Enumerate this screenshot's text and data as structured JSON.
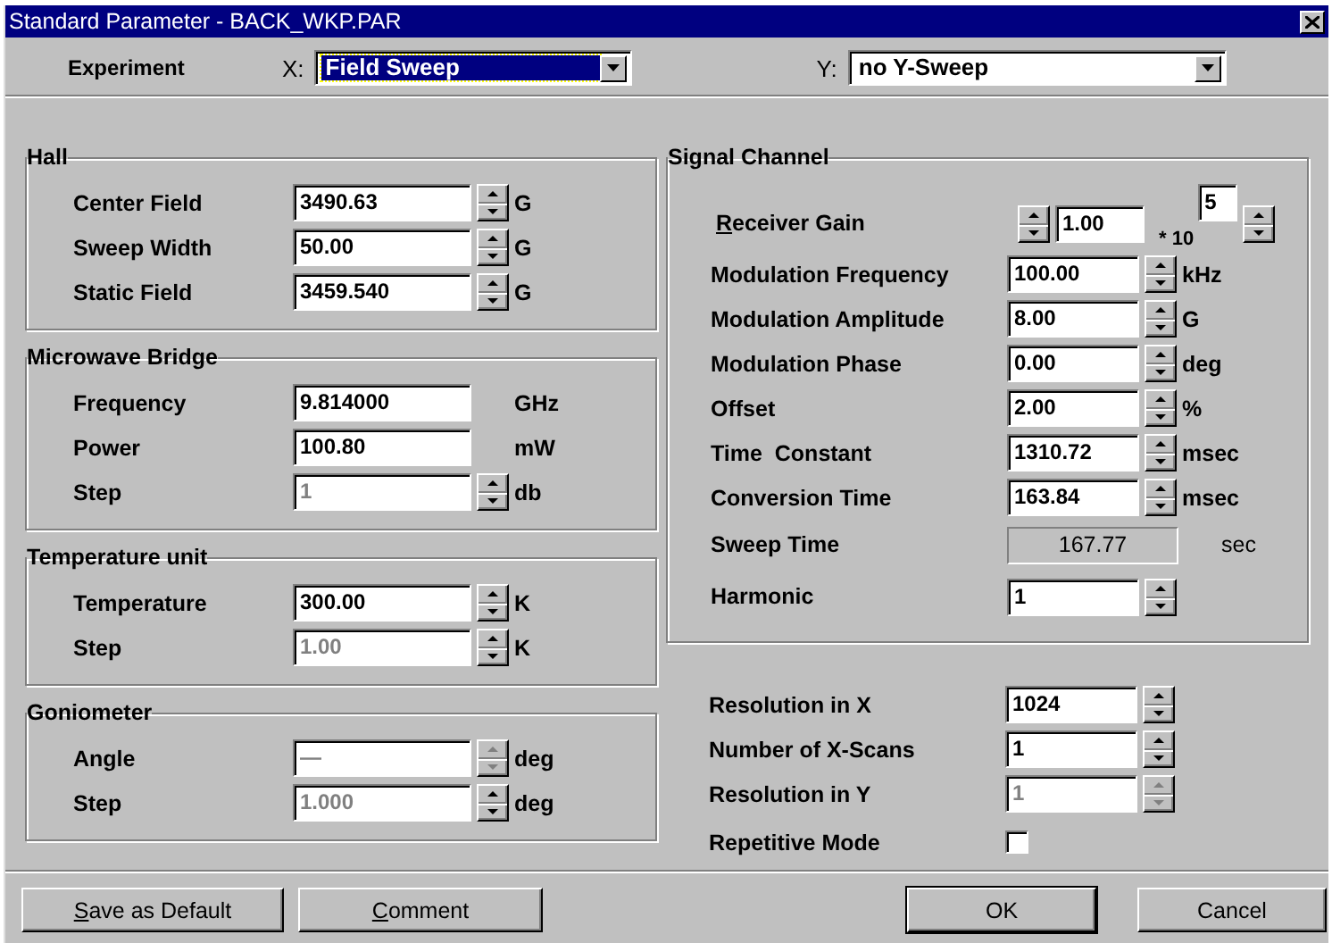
{
  "window": {
    "title": "Standard Parameter - BACK_WKP.PAR"
  },
  "experiment": {
    "label": "Experiment",
    "x": {
      "label": "X:",
      "value": "Field Sweep",
      "focused": true
    },
    "y": {
      "label": "Y:",
      "value": "no Y-Sweep",
      "focused": false
    }
  },
  "left_groups": [
    {
      "title": "Hall",
      "rows": [
        {
          "kind": "spin",
          "label": "Center Field",
          "value": "3490.63",
          "unit": "G",
          "disabled": false,
          "spinner_disabled": false
        },
        {
          "kind": "spin",
          "label": "Sweep Width",
          "value": "50.00",
          "unit": "G",
          "disabled": false,
          "spinner_disabled": false
        },
        {
          "kind": "spin",
          "label": "Static Field",
          "value": "3459.540",
          "unit": "G",
          "disabled": false,
          "spinner_disabled": false
        }
      ]
    },
    {
      "title": "Microwave Bridge",
      "rows": [
        {
          "kind": "plain",
          "label": "Frequency",
          "value": "9.814000",
          "unit": "GHz",
          "disabled": false
        },
        {
          "kind": "plain",
          "label": "Power",
          "value": "100.80",
          "unit": "mW",
          "disabled": false
        },
        {
          "kind": "spin",
          "label": "Step",
          "value": "1",
          "unit": "db",
          "disabled": true,
          "spinner_disabled": false
        }
      ]
    },
    {
      "title": "Temperature unit",
      "rows": [
        {
          "kind": "spin",
          "label": "Temperature",
          "value": "300.00",
          "unit": "K",
          "disabled": false,
          "spinner_disabled": false
        },
        {
          "kind": "spin",
          "label": "Step",
          "value": "1.00",
          "unit": "K",
          "disabled": true,
          "spinner_disabled": false
        }
      ]
    },
    {
      "title": "Goniometer",
      "rows": [
        {
          "kind": "spin",
          "label": "Angle",
          "value": "—",
          "unit": "deg",
          "disabled": true,
          "spinner_disabled": true
        },
        {
          "kind": "spin",
          "label": "Step",
          "value": "1.000",
          "unit": "deg",
          "disabled": true,
          "spinner_disabled": false
        }
      ]
    }
  ],
  "signal_channel": {
    "title": "Signal Channel",
    "rows": [
      {
        "kind": "gain",
        "label": "Receiver Gain",
        "underline_first": true,
        "value": "1.00",
        "multiplier": "* 10",
        "exponent": "5"
      },
      {
        "kind": "spin",
        "label": "Modulation Frequency",
        "value": "100.00",
        "unit": "kHz",
        "disabled": false,
        "spinner_disabled": false
      },
      {
        "kind": "spin",
        "label": "Modulation Amplitude",
        "value": "8.00",
        "unit": "G",
        "disabled": false,
        "spinner_disabled": false
      },
      {
        "kind": "spin",
        "label": "Modulation Phase",
        "value": "0.00",
        "unit": "deg",
        "disabled": false,
        "spinner_disabled": false
      },
      {
        "kind": "spin",
        "label": "Offset",
        "value": "2.00",
        "unit": "%",
        "disabled": false,
        "spinner_disabled": false
      },
      {
        "kind": "spin",
        "label": "Time  Constant",
        "value": "1310.72",
        "unit": "msec",
        "disabled": false,
        "spinner_disabled": false
      },
      {
        "kind": "spin",
        "label": "Conversion Time",
        "value": "163.84",
        "unit": "msec",
        "disabled": false,
        "spinner_disabled": false
      },
      {
        "kind": "readout",
        "label": "Sweep Time",
        "value": "167.77",
        "unit": "sec"
      },
      {
        "kind": "spin",
        "label": "Harmonic",
        "value": "1",
        "disabled": false,
        "spinner_disabled": false
      }
    ]
  },
  "scan_settings": [
    {
      "kind": "spin",
      "label": "Resolution in X",
      "value": "1024",
      "disabled": false,
      "spinner_disabled": false
    },
    {
      "kind": "spin",
      "label": "Number of X-Scans",
      "value": "1",
      "disabled": false,
      "spinner_disabled": false
    },
    {
      "kind": "spin",
      "label": "Resolution in Y",
      "value": "1",
      "disabled": true,
      "spinner_disabled": true
    },
    {
      "kind": "checkbox",
      "label": "Repetitive Mode",
      "checked": false
    }
  ],
  "buttons": [
    {
      "label": "Save as Default",
      "underline_first": true,
      "default": false
    },
    {
      "label": "Comment",
      "underline_first": true,
      "default": false
    },
    {
      "label": "OK",
      "underline_first": false,
      "default": true
    },
    {
      "label": "Cancel",
      "underline_first": false,
      "default": false
    }
  ]
}
